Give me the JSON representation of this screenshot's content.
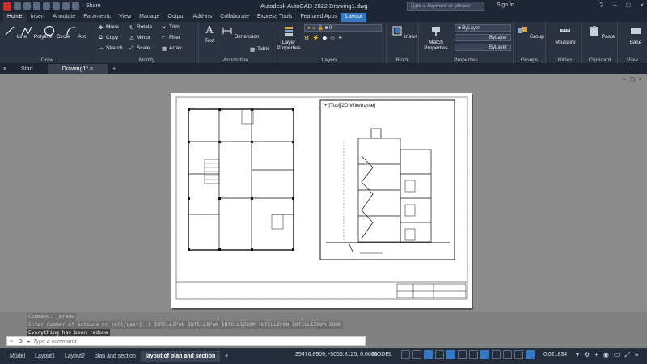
{
  "app": {
    "title": "Autodesk AutoCAD 2022    Drawing1.dwg",
    "share_label": "Share",
    "search_placeholder": "Type a keyword or phrase",
    "signin_label": "Sign In"
  },
  "ribbon_tabs": [
    "Home",
    "Insert",
    "Annotate",
    "Parametric",
    "View",
    "Manage",
    "Output",
    "Add-ins",
    "Collaborate",
    "Express Tools",
    "Featured Apps",
    "Layout"
  ],
  "ribbon": {
    "draw": {
      "name": "Draw",
      "line": "Line",
      "polyline": "Polyline",
      "circle": "Circle",
      "arc": "Arc"
    },
    "modify": {
      "name": "Modify",
      "move": "Move",
      "rotate": "Rotate",
      "trim": "Trim",
      "copy": "Copy",
      "mirror": "Mirror",
      "fillet": "Fillet",
      "stretch": "Stretch",
      "scale": "Scale",
      "array": "Array"
    },
    "annotation": {
      "name": "Annotation",
      "text": "Text",
      "dimension": "Dimension",
      "table": "Table"
    },
    "layers": {
      "name": "Layers",
      "layer_properties": "Layer Properties",
      "layer_value": "0"
    },
    "block": {
      "name": "Block",
      "insert": "Insert"
    },
    "properties": {
      "name": "Properties",
      "match": "Match Properties",
      "color": "ByLayer",
      "linetype": "ByLayer",
      "lineweight": "ByLayer"
    },
    "groups": {
      "name": "Groups",
      "group": "Group"
    },
    "utilities": {
      "name": "Utilities",
      "measure": "Measure"
    },
    "clipboard": {
      "name": "Clipboard",
      "paste": "Paste"
    },
    "view": {
      "name": "View",
      "base": "Base"
    }
  },
  "file_tabs": {
    "start": "Start",
    "drawing": "Drawing1*"
  },
  "viewport_label": "[+][Top][2D Wireframe]",
  "command": {
    "history": [
      "Command: _mredo",
      "Enter number of actions or [All/Last]: 1 INTELLIPAN INTELLIPAN INTELLIZOOM INTELLIPAN INTELLIZOOM ZOOM",
      "Everything has been redone"
    ],
    "placeholder": "Type a command"
  },
  "layout_tabs": [
    "Model",
    "Layout1",
    "Layout2",
    "plan and section",
    "layout of plan and section"
  ],
  "status": {
    "coords": "25476.8909, -5056.8125, 0.0000",
    "model": "MODEL",
    "scale": "0.021834"
  }
}
